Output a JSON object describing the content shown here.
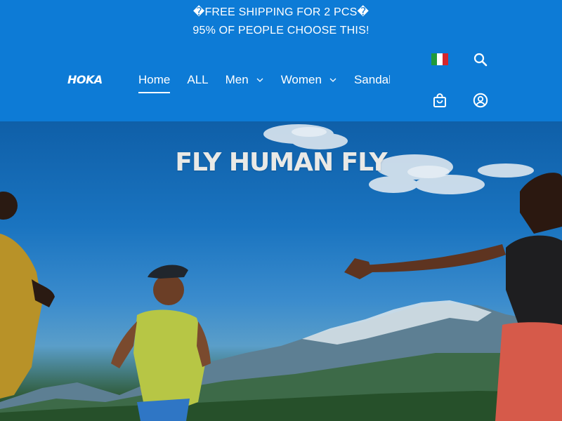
{
  "announcement": {
    "line1": "�FREE SHIPPING FOR 2 PCS�",
    "line2": "95% OF PEOPLE CHOOSE THIS!"
  },
  "brand": {
    "logo_text": "HOKA",
    "header_color": "#0d7bd6"
  },
  "nav": {
    "items": [
      {
        "label": "Home",
        "active": true,
        "has_dropdown": false
      },
      {
        "label": "ALL",
        "active": false,
        "has_dropdown": false
      },
      {
        "label": "Men",
        "active": false,
        "has_dropdown": true
      },
      {
        "label": "Women",
        "active": false,
        "has_dropdown": true
      },
      {
        "label": "Sandals",
        "active": false,
        "has_dropdown": false
      }
    ]
  },
  "header_icons": {
    "flag": "italy-flag-icon",
    "search": "search-icon",
    "cart": "shopping-bag-icon",
    "account": "account-icon"
  },
  "hero": {
    "title": "FLY HUMAN FLY"
  }
}
